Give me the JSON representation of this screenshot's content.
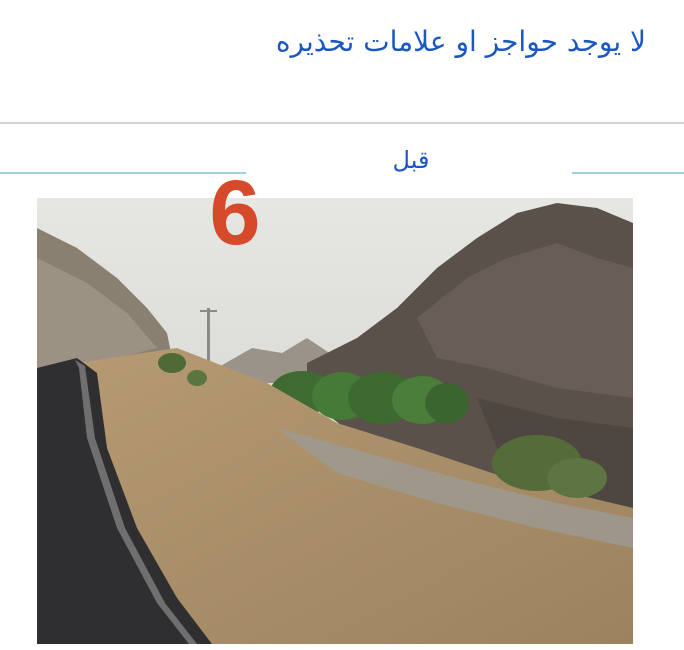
{
  "heading": "لا يوجد حواجز او علامات تحذيره",
  "before_label": "قبل",
  "photo_number": "6",
  "colors": {
    "heading": "#1a57c4",
    "number": "#d64a2b",
    "divider": "#d4d4d4",
    "accent_line": "#9fcfe0"
  }
}
